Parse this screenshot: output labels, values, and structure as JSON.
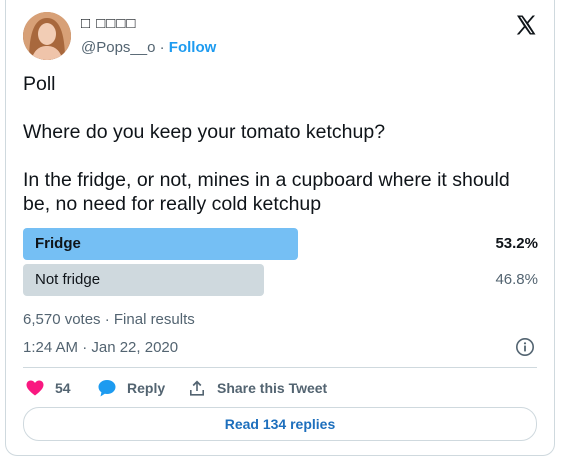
{
  "author": {
    "display_name": "□ □□□□",
    "handle": "@Pops__o",
    "separator": " · ",
    "follow_label": "Follow"
  },
  "tweet": {
    "text": "Poll\n\nWhere do you keep your tomato ketchup?\n\nIn the fridge, or not, mines in a cupboard where it should be, no need for really cold ketchup"
  },
  "poll": {
    "options": [
      {
        "label": "Fridge",
        "percent_text": "53.2%",
        "percent": 53.2,
        "winner": true
      },
      {
        "label": "Not fridge",
        "percent_text": "46.8%",
        "percent": 46.8,
        "winner": false
      }
    ],
    "summary": "6,570 votes · Final results"
  },
  "timestamp": "1:24 AM · Jan 22, 2020",
  "actions": {
    "like_count": "54",
    "reply_label": "Reply",
    "share_label": "Share this Tweet"
  },
  "read_replies_label": "Read 134 replies",
  "colors": {
    "winner_bar": "#75bff4",
    "other_bar": "#cfd9de",
    "like": "#f91880",
    "reply": "#1d9bf0",
    "link": "#1d6fbd"
  },
  "icons": [
    "x-logo-icon",
    "info-icon",
    "heart-icon",
    "reply-bubble-icon",
    "share-icon"
  ]
}
